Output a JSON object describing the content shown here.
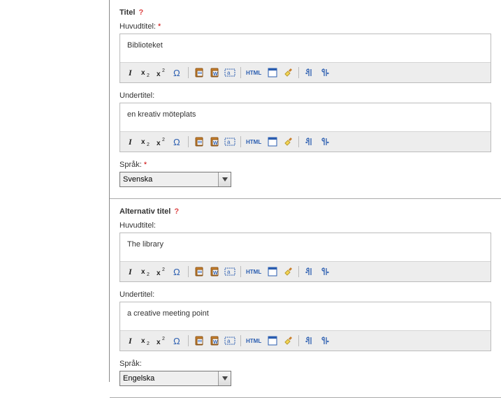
{
  "sections": {
    "titel": {
      "heading": "Titel",
      "help": "?",
      "huvudtitel_label": "Huvudtitel:",
      "huvudtitel_value": "Biblioteket",
      "undertitel_label": "Undertitel:",
      "undertitel_value": "en kreativ möteplats",
      "sprak_label": "Språk:",
      "sprak_value": "Svenska"
    },
    "alt_titel": {
      "heading": "Alternativ titel",
      "help": "?",
      "huvudtitel_label": "Huvudtitel:",
      "huvudtitel_value": "The library",
      "undertitel_label": "Undertitel:",
      "undertitel_value": "a creative meeting point",
      "sprak_label": "Språk:",
      "sprak_value": "Engelska"
    }
  },
  "required_mark": "*",
  "toolbar_hint": {
    "italic": "Italic",
    "sub": "Subscript",
    "sup": "Superscript",
    "omega": "Special char",
    "paste_text": "Paste text",
    "paste_word": "Paste Word",
    "abbr": "Abbreviation",
    "html": "HTML",
    "fullscreen": "Fullscreen",
    "clean": "Cleanup",
    "ltr": "LTR",
    "rtl": "RTL"
  }
}
